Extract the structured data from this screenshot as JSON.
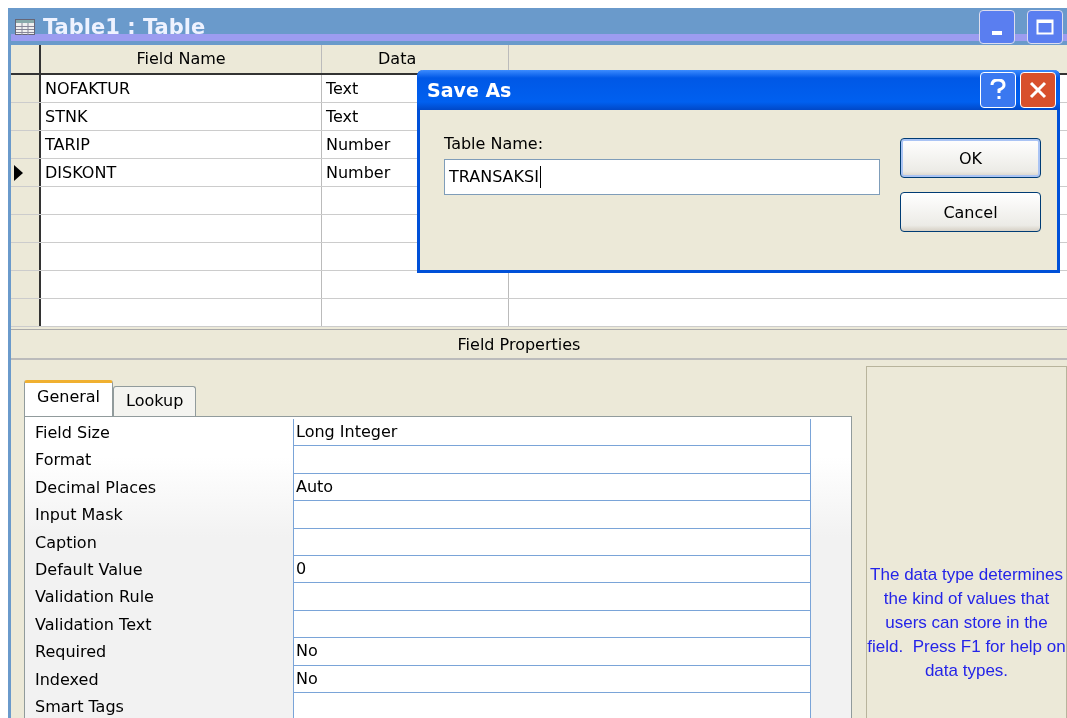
{
  "window": {
    "title": "Table1 : Table"
  },
  "design_grid": {
    "columns": [
      "Field Name",
      "Data"
    ],
    "rows": [
      {
        "field_name": "NOFAKTUR",
        "data_type": "Text",
        "selected": false
      },
      {
        "field_name": "STNK",
        "data_type": "Text",
        "selected": false
      },
      {
        "field_name": "TARIP",
        "data_type": "Number",
        "selected": false
      },
      {
        "field_name": "DISKONT",
        "data_type": "Number",
        "selected": true
      }
    ]
  },
  "field_properties": {
    "title": "Field Properties",
    "tabs": [
      {
        "label": "General",
        "selected": true
      },
      {
        "label": "Lookup",
        "selected": false
      }
    ],
    "properties": [
      {
        "label": "Field Size",
        "value": "Long Integer"
      },
      {
        "label": "Format"
      },
      {
        "label": "Decimal Places",
        "value": "Auto"
      },
      {
        "label": "Input Mask"
      },
      {
        "label": "Caption"
      },
      {
        "label": "Default Value",
        "value": "0"
      },
      {
        "label": "Validation Rule"
      },
      {
        "label": "Validation Text"
      },
      {
        "label": "Required",
        "value": "No"
      },
      {
        "label": "Indexed",
        "value": "No"
      },
      {
        "label": "Smart Tags"
      }
    ],
    "help_text": "The data type determines the kind of values that users can store in the field.  Press F1 for help on data types."
  },
  "dialog": {
    "title": "Save As",
    "field_label": "Table Name:",
    "field_value": "TRANSAKSI",
    "buttons": [
      "OK",
      "Cancel"
    ]
  }
}
